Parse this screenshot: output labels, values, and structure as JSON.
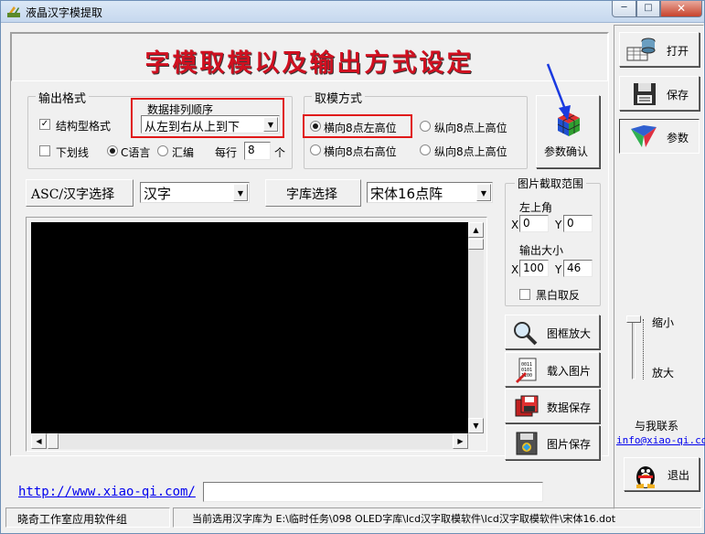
{
  "window": {
    "title": "液晶汉字模提取"
  },
  "banner": {
    "text": "字模取模以及输出方式设定"
  },
  "output_format": {
    "legend": "输出格式",
    "struct_format_label": "结构型格式",
    "struct_format_checked": true,
    "underline_label": "下划线",
    "underline_checked": false,
    "c_lang_label": "C语言",
    "asm_label": "汇编",
    "language_selected": "C语言",
    "per_line_label": "每行",
    "per_line_value": "8",
    "per_line_unit": "个",
    "order_label": "数据排列顺序",
    "order_selected": "从左到右从上到下"
  },
  "sampling_mode": {
    "legend": "取模方式",
    "options": [
      {
        "label": "横向8点左高位",
        "selected": true
      },
      {
        "label": "纵向8点上高位",
        "selected": false
      },
      {
        "label": "横向8点右高位",
        "selected": false
      },
      {
        "label": "纵向8点上高位",
        "selected": false
      }
    ]
  },
  "confirm_button": {
    "label": "参数确认"
  },
  "asc_select": {
    "label": "ASC/汉字选择",
    "selected": "汉字"
  },
  "font_select": {
    "label": "字库选择",
    "selected": "宋体16点阵"
  },
  "crop": {
    "legend": "图片截取范围",
    "top_left_label": "左上角",
    "x_label": "X",
    "y_label": "Y",
    "x_value": "0",
    "y_value": "0",
    "size_label": "输出大小",
    "width_value": "100",
    "height_value": "46",
    "invert_label": "黑白取反",
    "invert_checked": false
  },
  "tools": {
    "zoom_box": "图框放大",
    "load_image": "载入图片",
    "save_data": "数据保存",
    "save_image": "图片保存"
  },
  "right_panel": {
    "open": "打开",
    "save": "保存",
    "params": "参数",
    "zoom_out": "缩小",
    "zoom_in": "放大",
    "contact_label": "与我联系",
    "contact_email": "info@xiao-qi.com",
    "exit": "退出"
  },
  "footer": {
    "url": "http://www.xiao-qi.com/",
    "url_input_value": "",
    "studio": "晓奇工作室应用软件组",
    "status": "当前选用汉字库为 E:\\临时任务\\098 OLED字库\\lcd汉字取模软件\\lcd汉字取模软件\\宋体16.dot"
  },
  "colors": {
    "banner_red": "#d01020",
    "highlight_red": "#e01818",
    "canvas_black": "#000000",
    "link_blue": "#0000ee"
  }
}
